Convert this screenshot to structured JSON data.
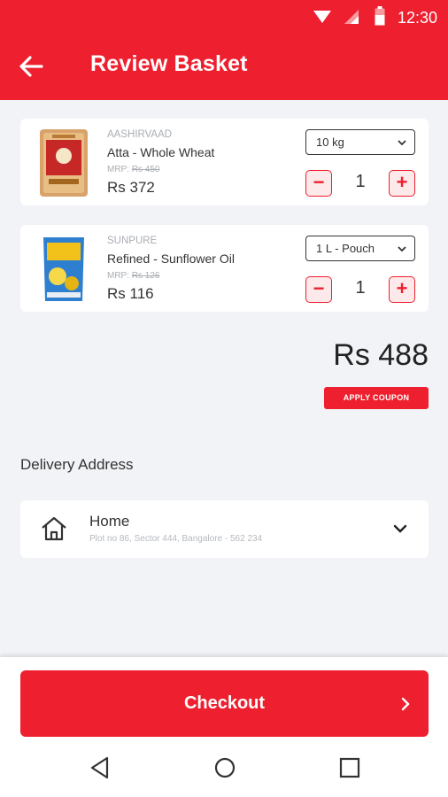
{
  "status_bar": {
    "time": "12:30",
    "icons": [
      "wifi-icon",
      "signal-icon",
      "battery-icon"
    ]
  },
  "header": {
    "title": "Review Basket",
    "back_icon": "arrow-left-icon"
  },
  "basket": {
    "items": [
      {
        "brand": "AASHIRVAAD",
        "name": "Atta - Whole Wheat",
        "mrp_label": "MRP:",
        "mrp": "Rs 450",
        "price": "Rs 372",
        "size": "10 kg",
        "quantity": "1"
      },
      {
        "brand": "SUNPURE",
        "name": "Refined - Sunflower Oil",
        "mrp_label": "MRP:",
        "mrp": "Rs 126",
        "price": "Rs 116",
        "size": "1 L - Pouch",
        "quantity": "1"
      }
    ],
    "minus_symbol": "−",
    "plus_symbol": "+"
  },
  "summary": {
    "total": "Rs 488",
    "coupon_label": "APPLY COUPON"
  },
  "delivery": {
    "heading": "Delivery Address",
    "address_label": "Home",
    "address_line": "Plot no 86, Sector 444, Bangalore - 562 234"
  },
  "footer": {
    "checkout_label": "Checkout"
  },
  "colors": {
    "brand_red": "#ee1f2e",
    "background": "#f1f3f6",
    "card": "#ffffff",
    "muted_text": "#a9adb3"
  }
}
